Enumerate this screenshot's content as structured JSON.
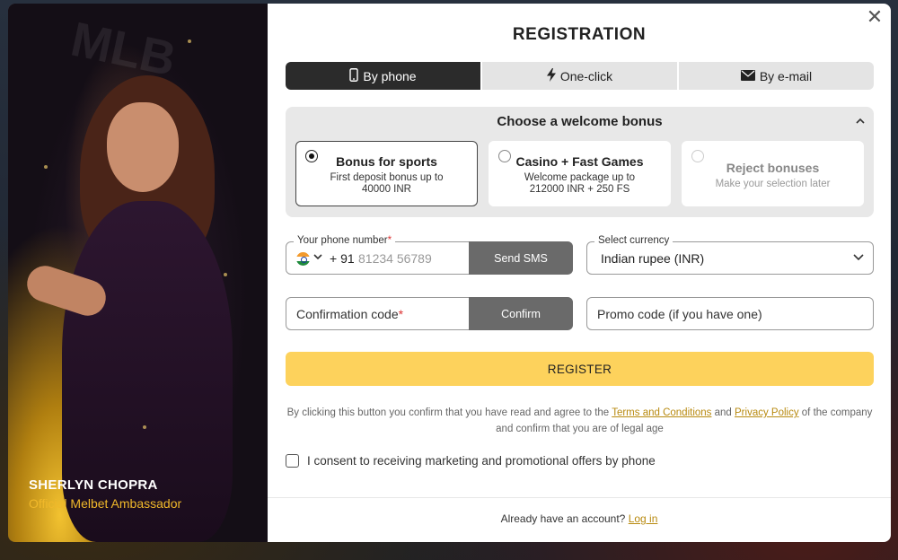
{
  "ambassador": {
    "name": "SHERLYN CHOPRA",
    "role": "Official Melbet Ambassador"
  },
  "modal": {
    "title": "REGISTRATION",
    "close_icon": "close-icon"
  },
  "tabs": [
    {
      "label": "By phone",
      "icon": "phone-icon",
      "active": true
    },
    {
      "label": "One-click",
      "icon": "lightning-icon",
      "active": false
    },
    {
      "label": "By e-mail",
      "icon": "envelope-icon",
      "active": false
    }
  ],
  "bonus": {
    "title": "Choose a welcome bonus",
    "options": [
      {
        "title": "Bonus for sports",
        "desc": "First deposit bonus up to 40000 INR",
        "selected": true
      },
      {
        "title": "Casino + Fast Games",
        "desc": "Welcome package up to 212000 INR + 250 FS",
        "selected": false
      },
      {
        "title": "Reject bonuses",
        "desc": "Make your selection later",
        "selected": false
      }
    ]
  },
  "phone": {
    "label": "Your phone number",
    "required_mark": "*",
    "dial_code": "+ 91",
    "placeholder": "81234 56789",
    "send_sms": "Send SMS"
  },
  "currency": {
    "label": "Select currency",
    "value": "Indian rupee (INR)"
  },
  "confirmation": {
    "placeholder": "Confirmation code",
    "required_mark": "*",
    "confirm": "Confirm"
  },
  "promo_code": {
    "placeholder": "Promo code (if you have one)"
  },
  "register": {
    "label": "REGISTER"
  },
  "legal": {
    "text_1": "By clicking this button you confirm that you have read and agree to the ",
    "terms": "Terms and Conditions",
    "text_2": " and ",
    "privacy": "Privacy Policy",
    "text_3": " of the company and confirm that you are of legal age"
  },
  "consent": {
    "label": "I consent to receiving marketing and promotional offers by phone",
    "checked": false
  },
  "login": {
    "text": "Already have an account? ",
    "link": "Log in"
  },
  "colors": {
    "accent_yellow": "#fdd25c",
    "active_tab": "#2b2b2b",
    "link": "#b88a10",
    "ambassador_role": "#f0b82a"
  }
}
